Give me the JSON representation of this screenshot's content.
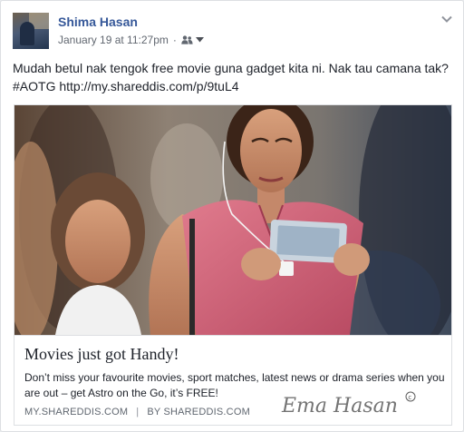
{
  "post": {
    "author": "Shima Hasan",
    "timestamp": "January 19 at 11:27pm",
    "separator": "·",
    "privacy_icon": "friends-icon",
    "message": "Mudah betul nak tengok free movie guna gadget kita ni. Nak tau camana tak? #AOTG http://my.shareddis.com/p/9tuL4"
  },
  "link_preview": {
    "title": "Movies just got Handy!",
    "description": "Don’t miss your favourite movies, sport matches, latest news or drama series when you are out – get Astro on the Go, it’s FREE!",
    "domain": "MY.SHAREDDIS.COM",
    "divider": "|",
    "byline": "BY SHAREDDIS.COM",
    "watermark": "Ema Hasan ©"
  },
  "colors": {
    "author_link": "#365899",
    "shirt": "#d8647a"
  }
}
